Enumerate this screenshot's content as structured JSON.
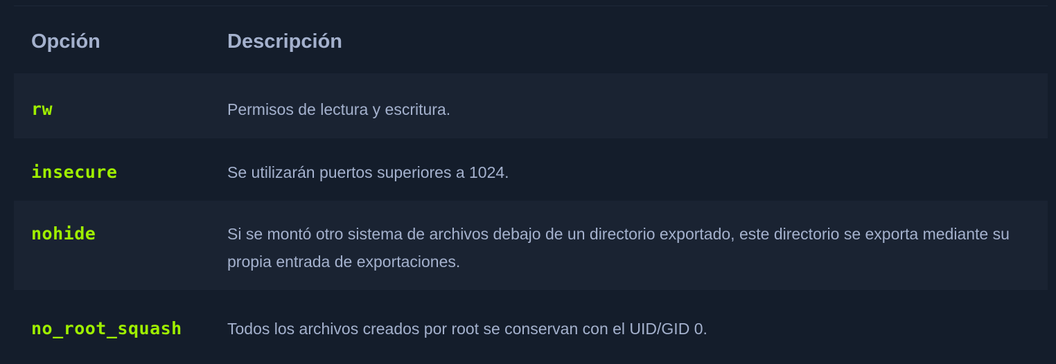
{
  "table": {
    "header": {
      "option": "Opción",
      "description": "Descripción"
    },
    "rows": [
      {
        "option": "rw",
        "description": "Permisos de lectura y escritura."
      },
      {
        "option": "insecure",
        "description": "Se utilizarán puertos superiores a 1024."
      },
      {
        "option": "nohide",
        "description": "Si se montó otro sistema de archivos debajo de un directorio exportado, este directorio se exporta mediante su propia entrada de exportaciones."
      },
      {
        "option": "no_root_squash",
        "description": "Todos los archivos creados por root se conservan con el UID/GID 0."
      }
    ]
  },
  "colors": {
    "background": "#141d2b",
    "row_alt": "#1a2332",
    "text": "#a4b1cd",
    "accent": "#9fef00"
  }
}
